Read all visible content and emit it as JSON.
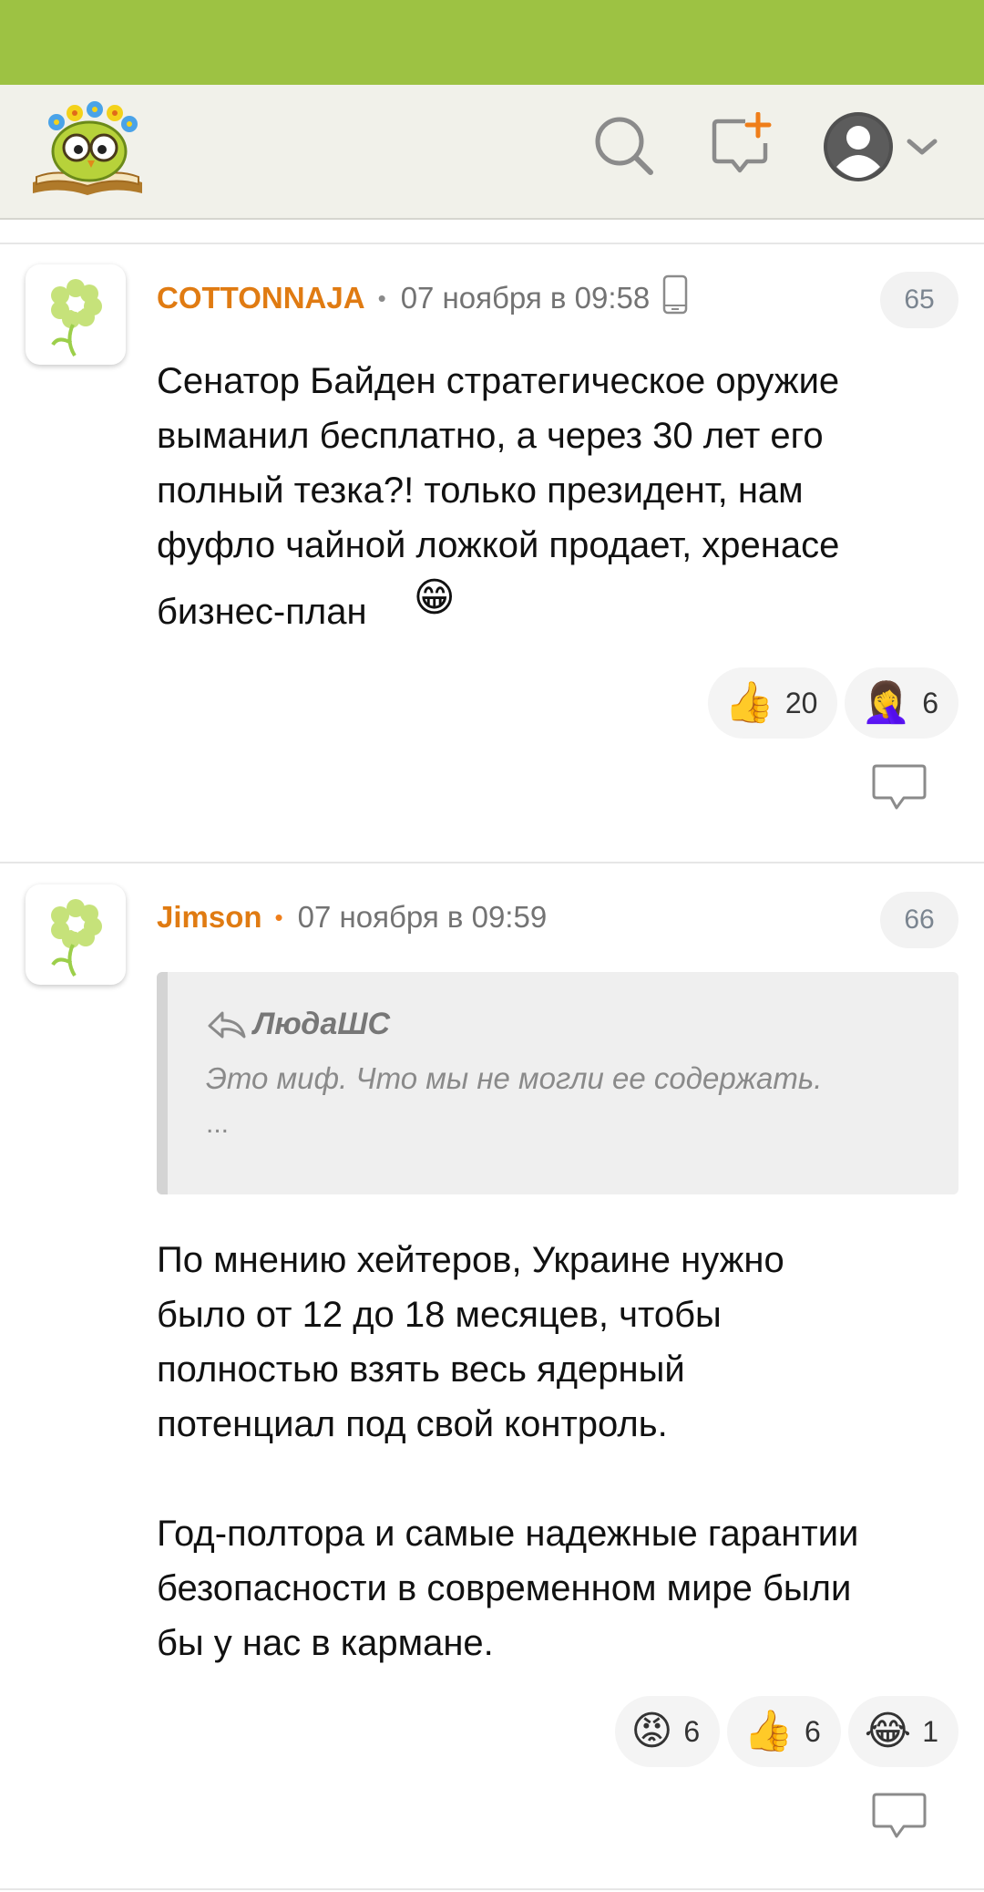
{
  "header": {
    "logo": "owl-book-logo",
    "icons": [
      "search-icon",
      "new-post-icon",
      "avatar-icon",
      "chevron-down-icon"
    ]
  },
  "colors": {
    "status_bar": "#9dc243",
    "author": "#e07b12",
    "header_bg": "#f1f1ea"
  },
  "comments": [
    {
      "author": "COTTONNAJA",
      "date": "07 ноября в 09:58",
      "device": "phone-icon",
      "number": "65",
      "text_lines": [
        "Сенатор Байден стратегическое оружие",
        "выманил бесплатно, а через 30 лет его",
        "полный тезка?! только президент, нам",
        "фуфло чайной ложкой продает, хренасе",
        "бизнес-план"
      ],
      "inline_emoji": "😁",
      "reactions": [
        {
          "emoji": "👍",
          "count": "20"
        },
        {
          "emoji": "🤦‍♀️",
          "count": "6"
        }
      ]
    },
    {
      "author": "Jimson",
      "date": "07 ноября в 09:59",
      "number": "66",
      "quote": {
        "author": "ЛюдаШС",
        "text": "Это миф. Что мы не могли ее содержать.",
        "more": "..."
      },
      "text_lines": [
        "По мнению хейтеров, Украине нужно",
        "было от 12 до 18 месяцев, чтобы",
        "полностью взять весь ядерный",
        "потенциал под свой контроль.",
        "",
        "Год-полтора и самые надежные гарантии",
        "безопасности в современном мире были",
        "бы у нас в кармане."
      ],
      "reactions": [
        {
          "emoji": "😡",
          "count": "6"
        },
        {
          "emoji": "👍",
          "count": "6"
        },
        {
          "emoji": "😂",
          "count": "1"
        }
      ]
    }
  ]
}
